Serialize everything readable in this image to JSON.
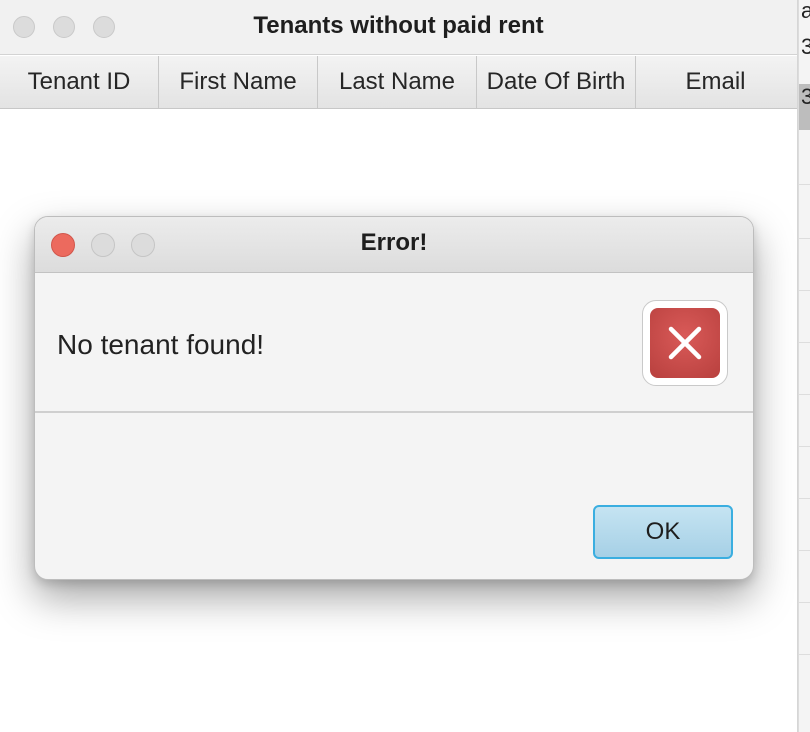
{
  "main_window": {
    "title": "Tenants without paid rent",
    "columns": [
      "Tenant ID",
      "First Name",
      "Last Name",
      "Date Of Birth",
      "Email"
    ]
  },
  "dialog": {
    "title": "Error!",
    "message": "No tenant found!",
    "icon": "error-x-icon",
    "ok_label": "OK"
  },
  "background_window": {
    "fragments": [
      "a",
      "3",
      "3"
    ]
  },
  "colors": {
    "close_red": "#ec6a5e",
    "error_red": "#c9494a",
    "ok_focus_blue": "#3aaee0"
  }
}
